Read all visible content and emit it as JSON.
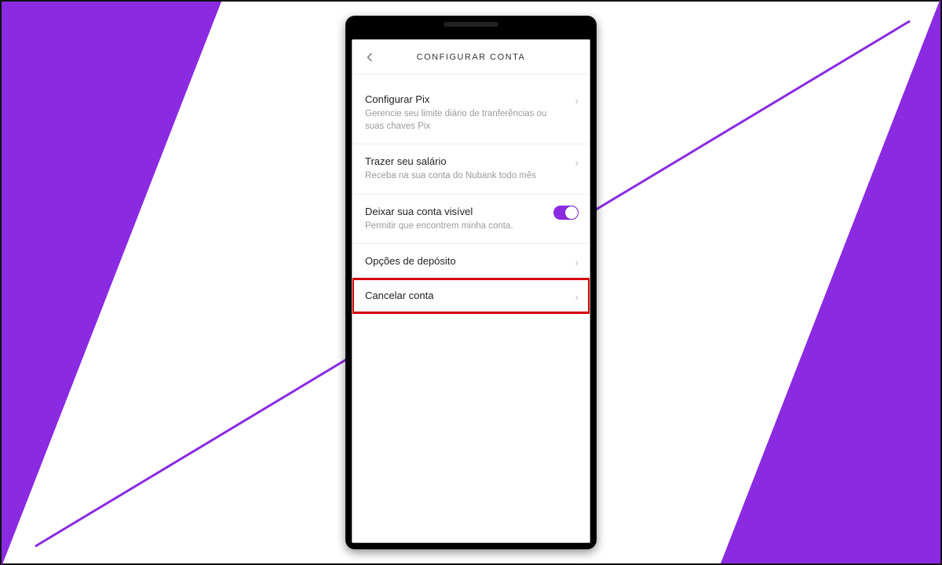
{
  "colors": {
    "accent": "#8a2be2",
    "highlight": "#d40000"
  },
  "header": {
    "title": "CONFIGURAR CONTA"
  },
  "items": {
    "pix": {
      "title": "Configurar Pix",
      "sub": "Gerencie seu limite diário de tranferências ou suas chaves Pix"
    },
    "salary": {
      "title": "Trazer seu salário",
      "sub": "Receba na sua conta do Nubank todo mês"
    },
    "visible": {
      "title": "Deixar sua conta visível",
      "sub": "Permitir que encontrem minha conta.",
      "toggle_on": true
    },
    "deposit": {
      "title": "Opções de depósito"
    },
    "cancel": {
      "title": "Cancelar conta"
    }
  }
}
